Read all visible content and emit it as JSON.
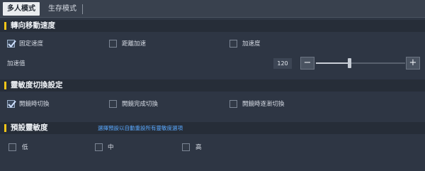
{
  "tabs": [
    {
      "label": "多人模式",
      "active": true
    },
    {
      "label": "生存模式",
      "active": false
    }
  ],
  "sections": {
    "turn_speed": {
      "title": "轉向移動速度",
      "options": [
        "固定速度",
        "距離加速",
        "加速度"
      ],
      "checked": [
        true,
        false,
        false
      ],
      "accel_label": "加速值",
      "accel_value": "120",
      "slider_level": 0.37,
      "minus": "−",
      "plus": "+"
    },
    "sensitivity_switch": {
      "title": "靈敏度切換設定",
      "options": [
        "開鏡時切換",
        "開鏡完成切換",
        "開鏡時逐漸切換"
      ],
      "checked": [
        true,
        false,
        false
      ]
    },
    "preset": {
      "title": "預設靈敏度",
      "hint": "選擇預設以自動重設所有靈敏度選項",
      "options": [
        "低",
        "中",
        "高"
      ],
      "checked": [
        false,
        false,
        false
      ]
    }
  },
  "colors": {
    "accent_bar": "#f2c518",
    "hint_text": "#5aa9ff",
    "background": "#2e3644"
  }
}
